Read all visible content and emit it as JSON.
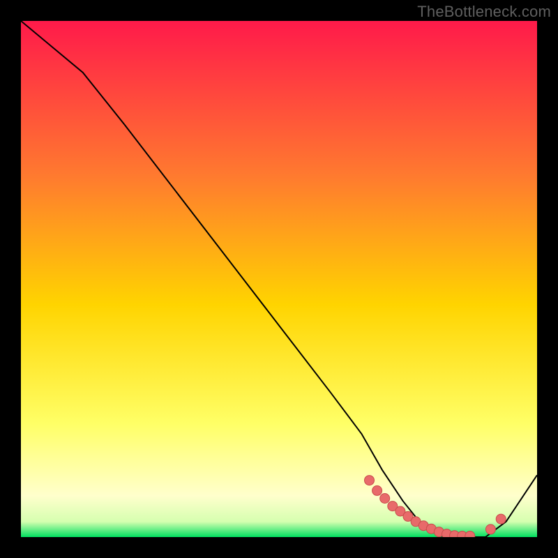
{
  "watermark": "TheBottleneck.com",
  "colors": {
    "background": "#000000",
    "grad_top": "#ff1a4a",
    "grad_mid_upper": "#ff7a2f",
    "grad_mid": "#ffd400",
    "grad_lower": "#ffff66",
    "grad_pale": "#ffffcc",
    "grad_green": "#00e060",
    "curve": "#000000",
    "dot_fill": "#e86a6a",
    "dot_stroke": "#c84b4b"
  },
  "chart_data": {
    "type": "line",
    "title": "",
    "xlabel": "",
    "ylabel": "",
    "xlim": [
      0,
      100
    ],
    "ylim": [
      0,
      100
    ],
    "series": [
      {
        "name": "bottleneck-curve",
        "x": [
          0,
          6,
          12,
          20,
          30,
          40,
          50,
          60,
          66,
          70,
          74,
          78,
          82,
          86,
          90,
          94,
          100
        ],
        "y": [
          100,
          95,
          90,
          80,
          67,
          54,
          41,
          28,
          20,
          13,
          7,
          2,
          0,
          0,
          0,
          3,
          12
        ]
      }
    ],
    "dots": {
      "name": "marker-dots",
      "x": [
        67.5,
        69,
        70.5,
        72,
        73.5,
        75,
        76.5,
        78,
        79.5,
        81,
        82.5,
        84,
        85.5,
        87,
        91,
        93
      ],
      "y": [
        11,
        9,
        7.5,
        6,
        5,
        4,
        3,
        2.2,
        1.6,
        1,
        0.6,
        0.3,
        0.2,
        0.2,
        1.5,
        3.5
      ]
    }
  }
}
